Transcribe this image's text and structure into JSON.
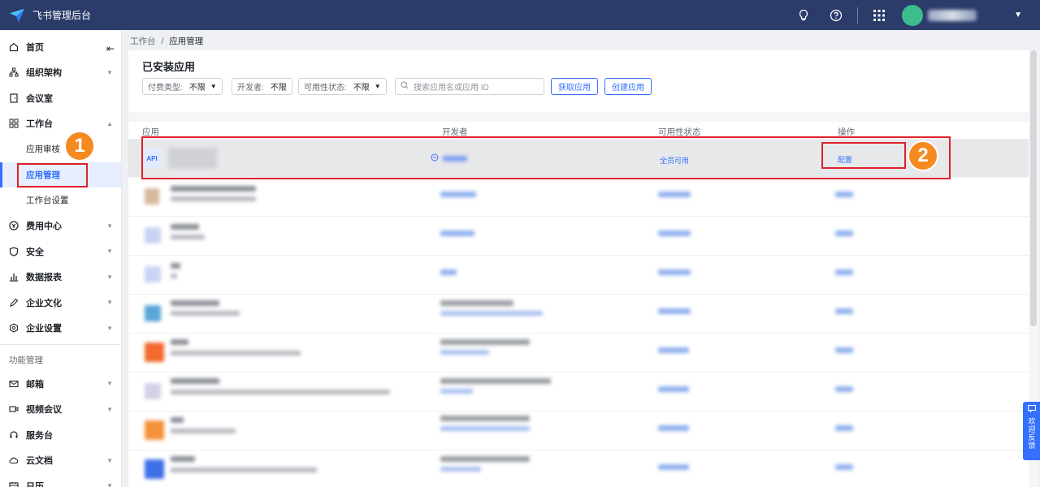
{
  "topbar": {
    "title": "飞书管理后台",
    "icons": [
      "bulb-icon",
      "help-icon",
      "apps-grid-icon",
      "avatar",
      "chevron-down-icon"
    ]
  },
  "sidebar": {
    "items": [
      {
        "label": "首页",
        "icon": "home-icon"
      },
      {
        "label": "组织架构",
        "icon": "org-icon"
      },
      {
        "label": "会议室",
        "icon": "room-icon"
      },
      {
        "label": "工作台",
        "icon": "workbench-icon"
      },
      {
        "label": "费用中心",
        "icon": "cost-icon"
      },
      {
        "label": "安全",
        "icon": "shield-icon"
      },
      {
        "label": "数据报表",
        "icon": "chart-icon"
      },
      {
        "label": "企业文化",
        "icon": "pen-icon"
      },
      {
        "label": "企业设置",
        "icon": "settings-icon"
      }
    ],
    "workbench_sub": [
      "应用审核",
      "应用管理",
      "工作台设置"
    ],
    "group_label": "功能管理",
    "feature_items": [
      {
        "label": "邮箱",
        "icon": "mail-icon"
      },
      {
        "label": "视频会议",
        "icon": "video-icon"
      },
      {
        "label": "服务台",
        "icon": "headset-icon"
      },
      {
        "label": "云文档",
        "icon": "cloud-doc-icon"
      },
      {
        "label": "日历",
        "icon": "calendar-icon"
      }
    ]
  },
  "markers": {
    "one": "1",
    "two": "2"
  },
  "breadcrumb": {
    "root": "工作台",
    "sep": "/",
    "current": "应用管理"
  },
  "main": {
    "title": "已安装应用",
    "filters": {
      "fee_label": "付费类型:",
      "fee_value": "不限",
      "dev_label": "开发者:",
      "dev_value": "不限",
      "avail_label": "可用性状态:",
      "avail_value": "不限"
    },
    "search_placeholder": "搜索应用名或应用 ID",
    "get_app_button": "获取应用",
    "create_app_button": "创建应用",
    "columns": [
      "应用",
      "开发者",
      "可用性状态",
      "操作"
    ],
    "first_row": {
      "icon_text": "API",
      "availability": "全员可用",
      "action": "配置"
    }
  },
  "feedback": "欢迎反馈",
  "colors": {
    "topbar": "#2b3b6a",
    "accent": "#3370ff",
    "marker": "#f58a1f",
    "highlight": "#e0202a"
  }
}
